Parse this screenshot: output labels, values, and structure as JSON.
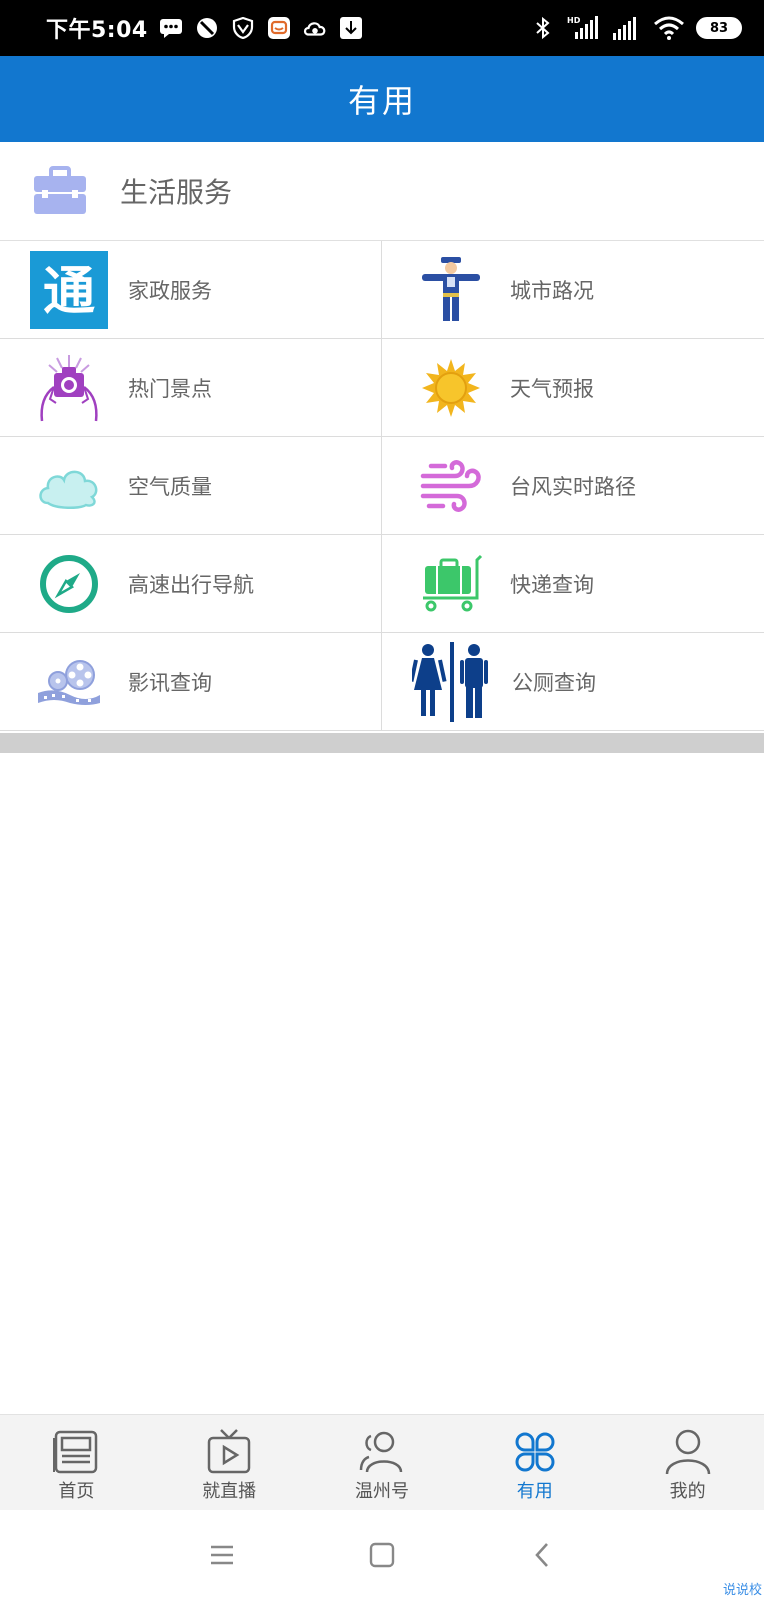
{
  "status_bar": {
    "time": "下午5:04",
    "battery": "83",
    "network_label": "HD"
  },
  "header": {
    "title": "有用"
  },
  "section": {
    "title": "生活服务",
    "icon": "briefcase-icon"
  },
  "services": [
    {
      "label": "家政服务",
      "icon": "tong-logo-icon",
      "color": "#1a9ad6"
    },
    {
      "label": "城市路况",
      "icon": "traffic-police-icon",
      "color": "#2b4fa3"
    },
    {
      "label": "热门景点",
      "icon": "camera-person-icon",
      "color": "#a040c0"
    },
    {
      "label": "天气预报",
      "icon": "sun-icon",
      "color": "#f2b51d"
    },
    {
      "label": "空气质量",
      "icon": "cloud-icon",
      "color": "#7fd8d8"
    },
    {
      "label": "台风实时路径",
      "icon": "wind-icon",
      "color": "#d46ad9"
    },
    {
      "label": "高速出行导航",
      "icon": "compass-icon",
      "color": "#1faa88"
    },
    {
      "label": "快递查询",
      "icon": "luggage-cart-icon",
      "color": "#3cc76a"
    },
    {
      "label": "影讯查询",
      "icon": "film-reel-icon",
      "color": "#8fa0dc"
    },
    {
      "label": "公厕查询",
      "icon": "restroom-icon",
      "color": "#0d3f8a"
    }
  ],
  "bottom_nav": [
    {
      "label": "首页",
      "icon": "newspaper-icon",
      "active": false
    },
    {
      "label": "就直播",
      "icon": "tv-play-icon",
      "active": false
    },
    {
      "label": "温州号",
      "icon": "people-icon",
      "active": false
    },
    {
      "label": "有用",
      "icon": "four-circles-icon",
      "active": true
    },
    {
      "label": "我的",
      "icon": "user-icon",
      "active": false
    }
  ],
  "colors": {
    "header": "#1277cf",
    "active_nav": "#1277cf"
  },
  "watermark": "说说校"
}
